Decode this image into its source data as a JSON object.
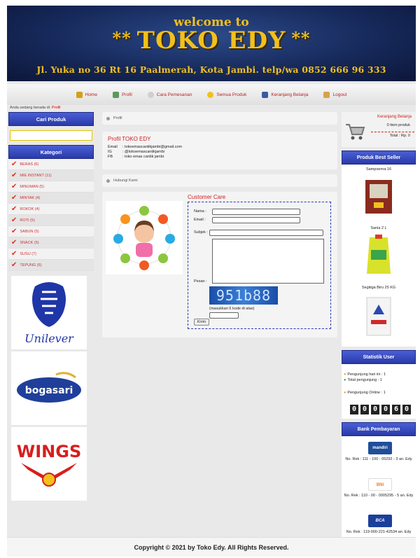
{
  "header": {
    "welcome": "welcome to",
    "title": "TOKO EDY",
    "stars": "**",
    "address": "Jl. Yuka no 36 Rt 16 Paalmerah, Kota Jambi. telp/wa 0852 666 96 333"
  },
  "nav": {
    "items": [
      {
        "label": "Home",
        "icon": "home-icon",
        "color": "#d4a017"
      },
      {
        "label": "Profil",
        "icon": "profile-icon",
        "color": "#5a9a5a"
      },
      {
        "label": "Cara Pemesanan",
        "icon": "info-icon",
        "color": "#d3d3d3"
      },
      {
        "label": "Semua Produk",
        "icon": "star-icon",
        "color": "#f2c01c"
      },
      {
        "label": "Keranjang Belanja",
        "icon": "cart-icon",
        "color": "#3a5aa0"
      },
      {
        "label": "Logout",
        "icon": "logout-icon",
        "color": "#d9a24a"
      }
    ]
  },
  "breadcrumb": {
    "prefix": "Anda sedang berada di:",
    "current": "Profil"
  },
  "sidebar": {
    "search_title": "Cari Produk",
    "category_title": "Kategori",
    "categories": [
      "BERAS (6)",
      "MIE INSTANT (11)",
      "MINUMAN (5)",
      "MINYAK (4)",
      "ROKOK (4)",
      "ROTI (5)",
      "SABUN (5)",
      "SNACK (5)",
      "SUSU (7)",
      "TEPUNG (6)"
    ],
    "brands": [
      "Unilever",
      "bogasari",
      "WINGS"
    ]
  },
  "main": {
    "profil_crumb": "Profil",
    "profile_title": "Profil TOKO EDY",
    "profile_rows": [
      {
        "key": "Email",
        "value": ": tokoemascantikjambi@gmail.com"
      },
      {
        "key": "IG",
        "value": ": @tokoemascantikjambi"
      },
      {
        "key": "FB",
        "value": ": toko emas cantik jambi"
      }
    ],
    "contact_crumb": "Hubungi Kami",
    "cs_title": "Customer Care",
    "form": {
      "name_label": "Nama :",
      "email_label": "Email :",
      "subject_label": "Subjek :",
      "message_label": "Pesan :",
      "captcha_code": "951b88",
      "captcha_hint": "(masukkan 6 kode di atas)",
      "submit_label": "Kirim"
    }
  },
  "cart": {
    "title": "Keranjang Belanja",
    "items": "0 item produk",
    "total": "Total : Rp. 0"
  },
  "best_seller": {
    "title": "Produk Best Seller",
    "items": [
      "Sampoerna 16",
      "Sania 2 L",
      "Segitiga Biru 25 KG"
    ]
  },
  "stats": {
    "title": "Statistik User",
    "today": "Pengunjung hari ini : 1",
    "total": "Total pengunjung : 1",
    "online": "Pengunjung Online : 1",
    "counter": [
      "0",
      "0",
      "0",
      "0",
      "6",
      "0"
    ]
  },
  "bank": {
    "title": "Bank Pembayaran",
    "accounts": [
      {
        "logo": "mandiri",
        "color": "#1f4e9a",
        "text": "No. Rek : 111 - 100 - 05292 - 3 an. Edy"
      },
      {
        "logo": "BNI",
        "color": "#f07a20",
        "text": "No. Rek : 110 - 00 - 0005295 - 5 an. Edy"
      },
      {
        "logo": "BCA",
        "color": "#1b3f9a",
        "text": "No. Rek : 119-000-221-42534 an. Edy"
      }
    ]
  },
  "footer": {
    "text": "Copyright © 2021 by Toko Edy. All Rights Reserved."
  }
}
